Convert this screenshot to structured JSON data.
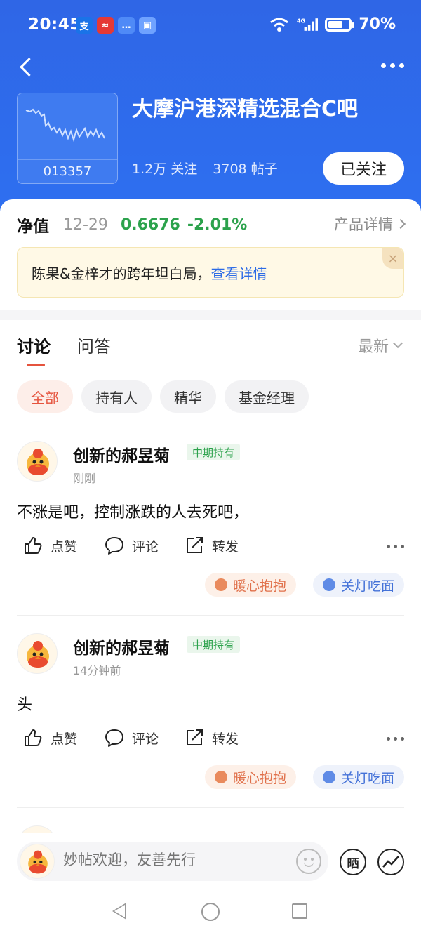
{
  "status_bar": {
    "time": "20:45",
    "icons": [
      {
        "name": "alipay-icon",
        "glyph": "支"
      },
      {
        "name": "red-app-icon",
        "glyph": "≈"
      },
      {
        "name": "message-icon",
        "glyph": "…"
      },
      {
        "name": "id-icon",
        "glyph": "▣"
      }
    ],
    "network": "4G",
    "battery": "70%",
    "battery_level": 0.7
  },
  "header": {
    "fund_title": "大摩沪港深精选混合C吧",
    "fund_code": "013357",
    "followers": "1.2万 关注",
    "posts": "3708 帖子",
    "follow_label": "已关注"
  },
  "nav": {
    "label": "净值",
    "date": "12-29",
    "value": "0.6676",
    "change": "-2.01%",
    "detail_link": "产品详情",
    "color_change": "#2ca24c"
  },
  "notice": {
    "text": "陈果&金梓才的跨年坦白局，",
    "link": "查看详情",
    "close": "×"
  },
  "tabs": {
    "items": [
      "讨论",
      "问答"
    ],
    "active": "讨论",
    "sort_label": "最新"
  },
  "chips": [
    "全部",
    "持有人",
    "精华",
    "基金经理"
  ],
  "posts": [
    {
      "author": "创新的郝昱菊",
      "badge": "中期持有",
      "time": "刚刚",
      "text": "不涨是吧，控制涨跌的人去死吧，",
      "actions": {
        "like": "点赞",
        "comment": "评论",
        "share": "转发"
      },
      "reactions": {
        "warm": "暖心抱抱",
        "light": "关灯吃面"
      }
    },
    {
      "author": "创新的郝昱菊",
      "badge": "中期持有",
      "time": "14分钟前",
      "text": "头",
      "actions": {
        "like": "点赞",
        "comment": "评论",
        "share": "转发"
      },
      "reactions": {
        "warm": "暖心抱抱",
        "light": "关灯吃面"
      }
    }
  ],
  "input_bar": {
    "placeholder": "妙帖欢迎，友善先行",
    "share_label": "晒"
  },
  "colors": {
    "brand_blue": "#2f66e6",
    "accent_red": "#e5533d",
    "green": "#2ca24c",
    "link_blue": "#2c6be6"
  }
}
